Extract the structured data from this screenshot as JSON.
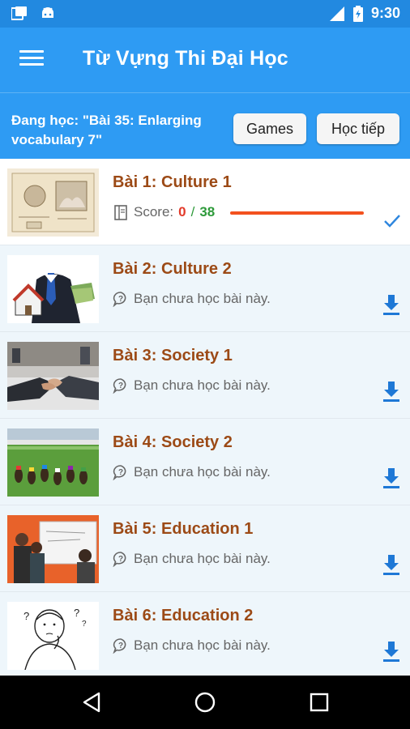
{
  "status_bar": {
    "time": "9:30",
    "left_icons": [
      "screenshot-icon",
      "android-icon"
    ],
    "right_icons": [
      "signal-icon",
      "battery-charging-icon"
    ]
  },
  "app_bar": {
    "title": "Từ Vựng Thi Đại Học",
    "menu_icon": "menu-icon"
  },
  "learning": {
    "text": "Đang học: \"Bài 35: Enlarging vocabulary 7\"",
    "games_label": "Games",
    "continue_label": "Học tiếp"
  },
  "lessons": [
    {
      "title": "Bài 1: Culture 1",
      "score_label": "Score:",
      "score": "0",
      "score_sep": "/",
      "total": "38",
      "progress": 0,
      "status": "done"
    },
    {
      "title": "Bài 2: Culture 2",
      "status_text": "Bạn chưa học bài này."
    },
    {
      "title": "Bài 3: Society 1",
      "status_text": "Bạn chưa học bài này."
    },
    {
      "title": "Bài 4: Society 2",
      "status_text": "Bạn chưa học bài này."
    },
    {
      "title": "Bài 5: Education 1",
      "status_text": "Bạn chưa học bài này."
    },
    {
      "title": "Bài 6: Education 2",
      "status_text": "Bạn chưa học bài này."
    }
  ],
  "colors": {
    "primary": "#2e9bf3",
    "status_bar": "#2289e0",
    "lesson_title": "#9c4a16",
    "score_red": "#e23a2a",
    "score_green": "#2e9a3a",
    "progress": "#f3511e",
    "download": "#1e78d6"
  },
  "nav": [
    "back-icon",
    "home-icon",
    "recents-icon"
  ]
}
